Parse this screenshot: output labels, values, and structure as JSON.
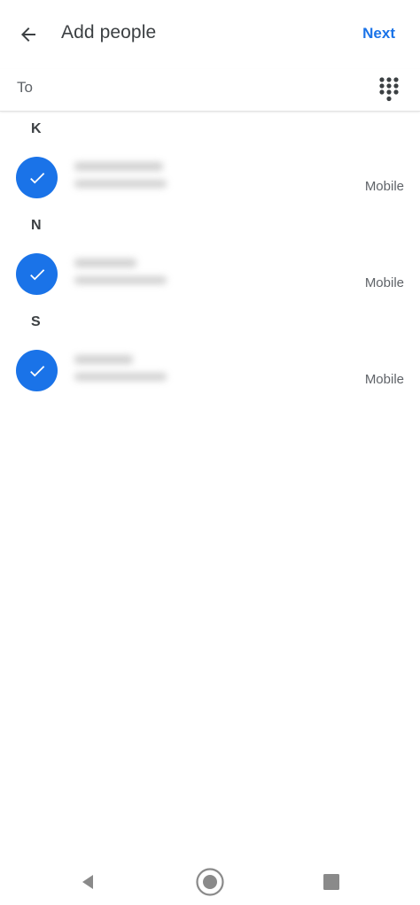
{
  "header": {
    "title": "Add people",
    "next_label": "Next",
    "back_icon": "arrow-back-icon"
  },
  "to_field": {
    "label": "To",
    "value": "",
    "placeholder": "",
    "dialpad_icon": "dialpad-icon"
  },
  "sections": [
    {
      "letter": "K",
      "contacts": [
        {
          "name": "",
          "number": "",
          "type": "Mobile",
          "selected": true
        }
      ]
    },
    {
      "letter": "N",
      "contacts": [
        {
          "name": "",
          "number": "",
          "type": "Mobile",
          "selected": true
        }
      ]
    },
    {
      "letter": "S",
      "contacts": [
        {
          "name": "",
          "number": "",
          "type": "Mobile",
          "selected": true
        }
      ]
    }
  ],
  "navbar": {
    "back_icon": "nav-back-icon",
    "home_icon": "nav-home-icon",
    "recents_icon": "nav-recents-icon"
  },
  "colors": {
    "accent": "#1a73e8",
    "text_primary": "#3c4043",
    "text_secondary": "#5f6368",
    "nav_icon": "#8a8a8a"
  }
}
